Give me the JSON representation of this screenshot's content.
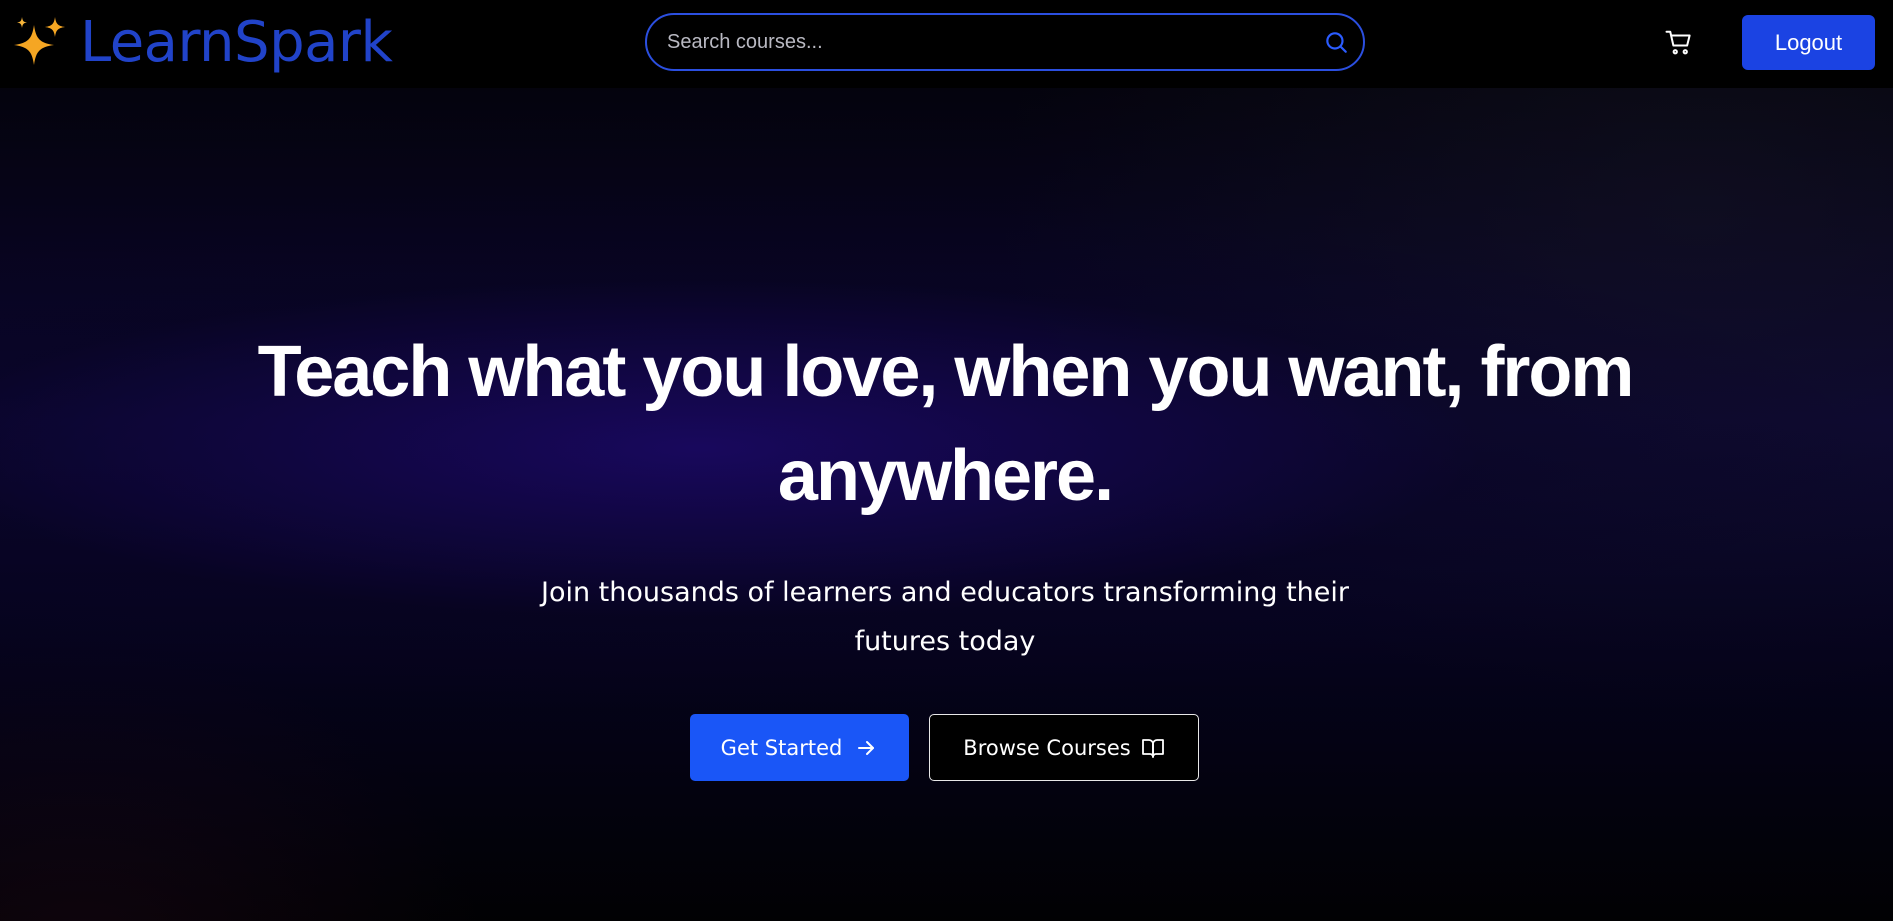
{
  "header": {
    "brand": "LearnSpark",
    "logo_icon": "sparkles-icon",
    "search": {
      "placeholder": "Search courses...",
      "value": "",
      "icon": "search-icon"
    },
    "cart_icon": "shopping-cart-icon",
    "logout_label": "Logout"
  },
  "hero": {
    "title": "Teach what you love, when you want, from anywhere.",
    "subtitle": "Join thousands of learners and educators transforming their futures today",
    "primary_button": {
      "label": "Get Started",
      "icon": "arrow-right-icon"
    },
    "secondary_button": {
      "label": "Browse Courses",
      "icon": "open-book-icon"
    }
  },
  "colors": {
    "brand": "#2143c9",
    "accent": "#1b43e3",
    "primary_button": "#1a56f7",
    "sparkle": "#f5a623",
    "background": "#000000"
  }
}
